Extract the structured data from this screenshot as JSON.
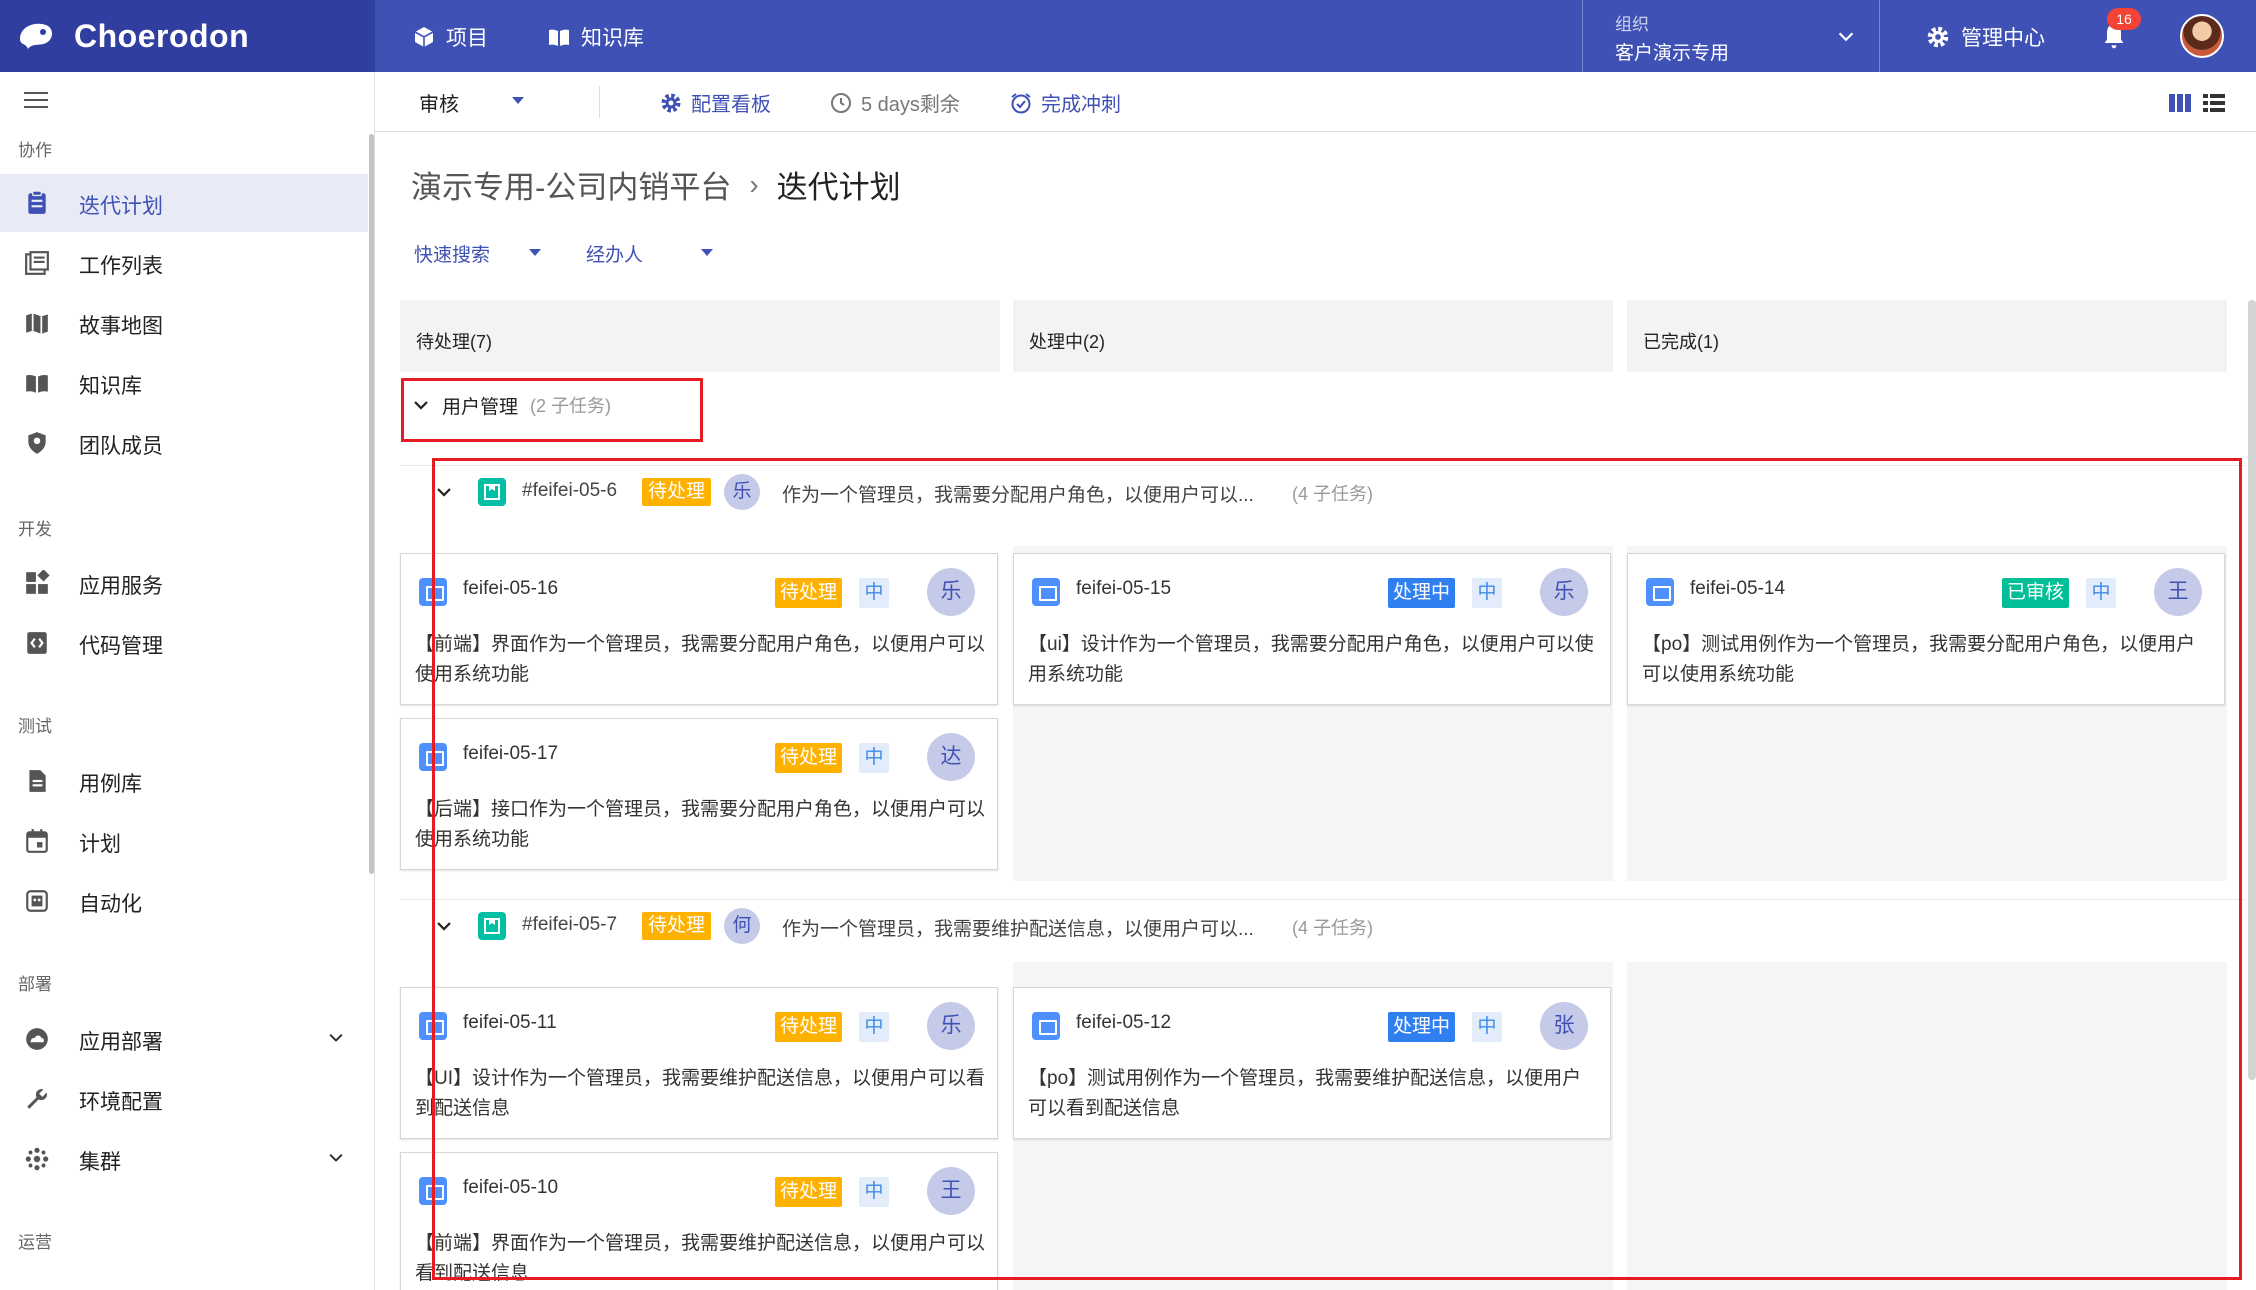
{
  "app": {
    "name": "Choerodon"
  },
  "topnav": {
    "project": "项目",
    "knowledge": "知识库"
  },
  "org": {
    "label": "组织",
    "value": "客户演示专用"
  },
  "admin": {
    "label": "管理中心"
  },
  "notifications": {
    "count": "16"
  },
  "sidebar": {
    "groups": [
      "协作",
      "开发",
      "测试",
      "部署",
      "运营"
    ],
    "items": [
      {
        "label": "迭代计划",
        "icon": "clipboard-icon",
        "active": true
      },
      {
        "label": "工作列表",
        "icon": "list-icon"
      },
      {
        "label": "故事地图",
        "icon": "map-icon"
      },
      {
        "label": "知识库",
        "icon": "book-icon"
      },
      {
        "label": "团队成员",
        "icon": "shield-icon"
      },
      {
        "label": "应用服务",
        "icon": "apps-icon"
      },
      {
        "label": "代码管理",
        "icon": "code-icon"
      },
      {
        "label": "用例库",
        "icon": "document-icon"
      },
      {
        "label": "计划",
        "icon": "calendar-icon"
      },
      {
        "label": "自动化",
        "icon": "robot-icon"
      },
      {
        "label": "应用部署",
        "icon": "cloud-icon",
        "expandable": true
      },
      {
        "label": "环境配置",
        "icon": "wrench-icon"
      },
      {
        "label": "集群",
        "icon": "cluster-icon",
        "expandable": true
      }
    ]
  },
  "toolbar": {
    "board_select": "审核",
    "config_board": "配置看板",
    "days_left": "5 days剩余",
    "complete_sprint": "完成冲刺"
  },
  "breadcrumb": {
    "project": "演示专用-公司内销平台",
    "separator": "›",
    "page": "迭代计划"
  },
  "filters": {
    "quick_search": "快速搜索",
    "assignee": "经办人"
  },
  "columns": [
    "待处理(7)",
    "处理中(2)",
    "已完成(1)"
  ],
  "group": {
    "title": "用户管理",
    "subtasks": "(2 子任务)"
  },
  "stories": [
    {
      "id": "#feifei-05-6",
      "status": "待处理",
      "assignee": "乐",
      "title": "作为一个管理员，我需要分配用户角色，以便用户可以...",
      "subtasks": "(4 子任务)",
      "cards": [
        {
          "id": "feifei-05-16",
          "status": "待处理",
          "priority": "中",
          "assignee": "乐",
          "desc": "【前端】界面作为一个管理员，我需要分配用户角色，以便用户可以使用系统功能"
        },
        {
          "id": "feifei-05-15",
          "status": "处理中",
          "priority": "中",
          "assignee": "乐",
          "desc": "【ui】设计作为一个管理员，我需要分配用户角色，以便用户可以使用系统功能"
        },
        {
          "id": "feifei-05-14",
          "status": "已审核",
          "priority": "中",
          "assignee": "王",
          "desc": "【po】测试用例作为一个管理员，我需要分配用户角色，以便用户可以使用系统功能"
        },
        {
          "id": "feifei-05-17",
          "status": "待处理",
          "priority": "中",
          "assignee": "达",
          "desc": "【后端】接口作为一个管理员，我需要分配用户角色，以便用户可以使用系统功能"
        }
      ]
    },
    {
      "id": "#feifei-05-7",
      "status": "待处理",
      "assignee": "何",
      "title": "作为一个管理员，我需要维护配送信息，以便用户可以...",
      "subtasks": "(4 子任务)",
      "cards": [
        {
          "id": "feifei-05-11",
          "status": "待处理",
          "priority": "中",
          "assignee": "乐",
          "desc": "【UI】设计作为一个管理员，我需要维护配送信息，以便用户可以看到配送信息"
        },
        {
          "id": "feifei-05-12",
          "status": "处理中",
          "priority": "中",
          "assignee": "张",
          "desc": "【po】测试用例作为一个管理员，我需要维护配送信息，以便用户可以看到配送信息"
        },
        {
          "id": "feifei-05-10",
          "status": "待处理",
          "priority": "中",
          "assignee": "王",
          "desc": "【前端】界面作为一个管理员，我需要维护配送信息，以便用户可以看到配送信息"
        }
      ]
    }
  ],
  "colors": {
    "primary": "#3f51b5",
    "header_dark": "#303f9f",
    "todo": "#ffb100",
    "doing": "#2f7ff0",
    "done": "#00bf96",
    "highlight": "#e51c23"
  }
}
